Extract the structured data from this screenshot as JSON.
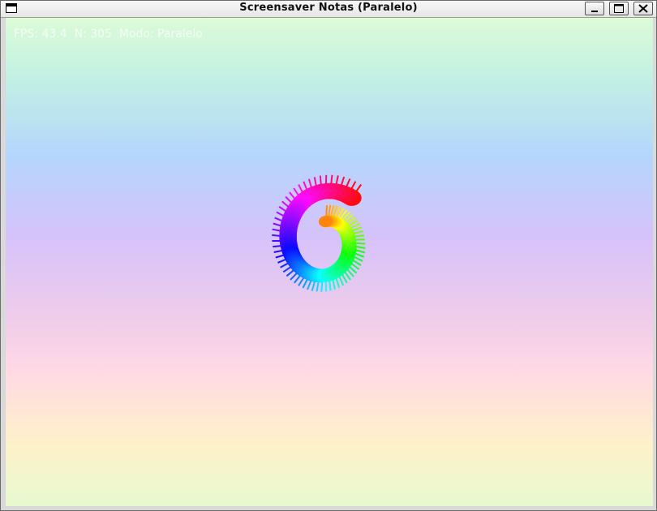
{
  "window": {
    "title": "Screensaver Notas (Paralelo)",
    "buttons": {
      "minimize": "minimize-icon",
      "maximize": "maximize-icon",
      "close": "close-icon"
    }
  },
  "overlay": {
    "text": "FPS: 43.4  N: 305  Modo: Paralelo"
  },
  "colors": {
    "background_stops": [
      "#dcfbd7",
      "#b4d6fc",
      "#d6c2fb",
      "#ffd9e4",
      "#fdf2c8",
      "#e7f9d1"
    ]
  },
  "scene": {
    "shape": "rainbow-spiral-notes"
  }
}
